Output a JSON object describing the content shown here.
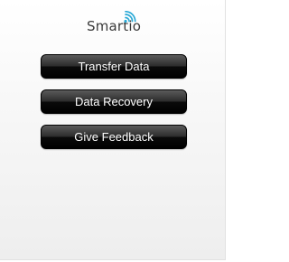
{
  "app": {
    "logo_text": "Smartio",
    "logo_icon": "wifi-signal-icon",
    "colors": {
      "logo_text": "#3a3a3a",
      "logo_signal": "#2aa9d6",
      "button_background": "#000000",
      "button_text": "#ffffff",
      "page_background": "#f2f2f2"
    }
  },
  "menu": {
    "items": [
      {
        "label": "Transfer Data"
      },
      {
        "label": "Data Recovery"
      },
      {
        "label": "Give Feedback"
      }
    ]
  }
}
